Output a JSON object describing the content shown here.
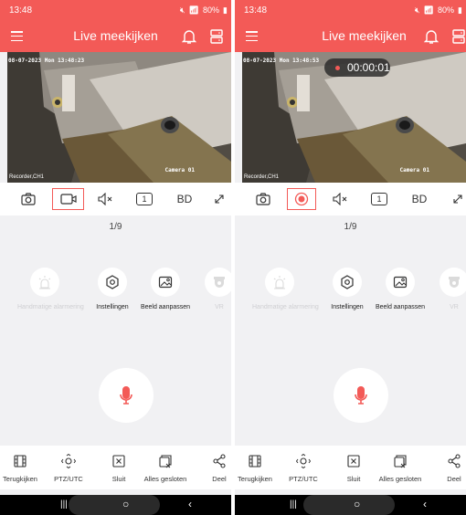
{
  "colors": {
    "accent": "#f35a57",
    "panel_bg": "#f1f1f3"
  },
  "panels": [
    {
      "status": {
        "time": "13:48",
        "battery": "80%"
      },
      "header": {
        "title": "Live meekijken"
      },
      "video": {
        "osd_date": "08-07-2023 Mon 13:48:23",
        "osd_camera": "Camera 01",
        "osd_channel": "Recorder,CH1",
        "recording_timer": ""
      },
      "controls": {
        "quality": "BD",
        "window_number": "1",
        "highlighted": "record-video-button"
      },
      "page_indicator": "1/9",
      "functions": [
        "Handmatige alarmering",
        "Instellingen",
        "Beeld aanpassen",
        "VR"
      ],
      "toolbar": [
        "Terugkijken",
        "PTZ/UTC",
        "Sluit",
        "Alles gesloten",
        "Deel"
      ]
    },
    {
      "status": {
        "time": "13:48",
        "battery": "80%"
      },
      "header": {
        "title": "Live meekijken"
      },
      "video": {
        "osd_date": "08-07-2023 Mon 13:48:53",
        "osd_camera": "Camera 01",
        "osd_channel": "Recorder,CH1",
        "recording_timer": "00:00:01"
      },
      "controls": {
        "quality": "BD",
        "window_number": "1",
        "highlighted": "stop-recording-button"
      },
      "page_indicator": "1/9",
      "functions": [
        "Handmatige alarmering",
        "Instellingen",
        "Beeld aanpassen",
        "VR"
      ],
      "toolbar": [
        "Terugkijken",
        "PTZ/UTC",
        "Sluit",
        "Alles gesloten",
        "Deel"
      ]
    }
  ]
}
